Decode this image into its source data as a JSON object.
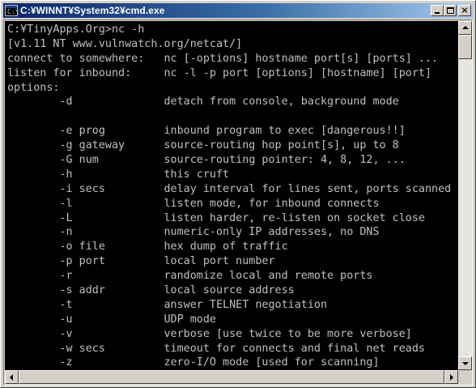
{
  "window": {
    "title": "C:¥WINNT¥System32¥cmd.exe",
    "icon_glyph": "C:\\",
    "controls": {
      "minimize": "minimize-icon",
      "maximize": "maximize-icon",
      "close": "×"
    }
  },
  "console": {
    "lines": [
      "C:¥TinyApps.Org>nc -h",
      "[v1.11 NT www.vulnwatch.org/netcat/]",
      "connect to somewhere:   nc [-options] hostname port[s] [ports] ...",
      "listen for inbound:     nc -l -p port [options] [hostname] [port]",
      "options:",
      "        -d              detach from console, background mode",
      "",
      "        -e prog         inbound program to exec [dangerous!!]",
      "        -g gateway      source-routing hop point[s], up to 8",
      "        -G num          source-routing pointer: 4, 8, 12, ...",
      "        -h              this cruft",
      "        -i secs         delay interval for lines sent, ports scanned",
      "        -l              listen mode, for inbound connects",
      "        -L              listen harder, re-listen on socket close",
      "        -n              numeric-only IP addresses, no DNS",
      "        -o file         hex dump of traffic",
      "        -p port         local port number",
      "        -r              randomize local and remote ports",
      "        -s addr         local source address",
      "        -t              answer TELNET negotiation",
      "        -u              UDP mode",
      "        -v              verbose [use twice to be more verbose]",
      "        -w secs         timeout for connects and final net reads",
      "        -z              zero-I/O mode [used for scanning]"
    ]
  },
  "colors": {
    "console_bg": "#000000",
    "console_fg": "#c0c0c0",
    "title_active": "#0a246a"
  }
}
